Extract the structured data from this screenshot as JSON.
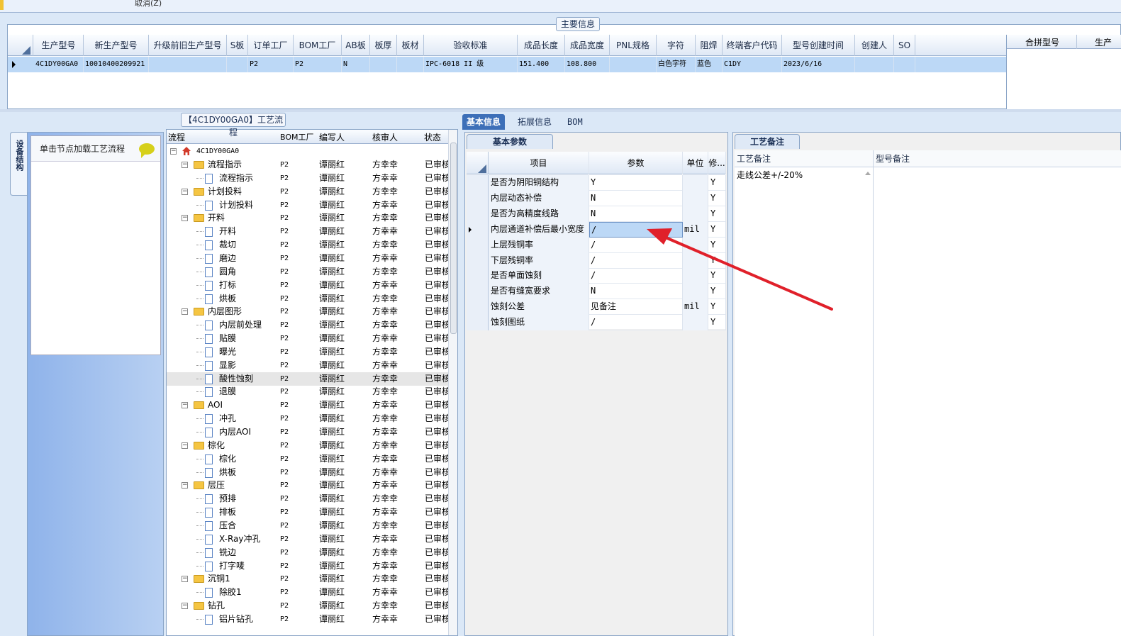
{
  "top_strip": {
    "text": "取消(Z)"
  },
  "main_info": {
    "caption": "主要信息",
    "headers": [
      "生产型号",
      "新生产型号",
      "升级前旧生产型号",
      "S板",
      "订单工厂",
      "BOM工厂",
      "AB板",
      "板厚",
      "板材",
      "验收标准",
      "成品长度",
      "成品宽度",
      "PNL规格",
      "字符",
      "阻焊",
      "终端客户代码",
      "型号创建时间",
      "创建人",
      "SO"
    ],
    "row": [
      "4C1DY00GA0",
      "10010400209921",
      "",
      "",
      "P2",
      "P2",
      "N",
      "",
      "",
      "IPC-6018 II 级",
      "151.400",
      "108.800",
      "",
      "白色字符",
      "蓝色",
      "C1DY",
      "2023/6/16",
      "",
      ""
    ],
    "right_headers": [
      "合拼型号",
      "生产"
    ]
  },
  "device_panel": {
    "tab_label": "设备结构",
    "button_label": "单击节点加载工艺流程"
  },
  "process_tree": {
    "caption": "【4C1DY00GA0】工艺流程",
    "headers": [
      "流程",
      "BOM工厂",
      "编写人",
      "核审人",
      "状态"
    ],
    "root": "4C1DY00GA0",
    "rows": [
      {
        "name": "流程指示",
        "level": 1,
        "factory": "P2",
        "writer": "谭丽红",
        "reviewer": "方幸幸",
        "status": "已审核"
      },
      {
        "name": "流程指示",
        "level": 2,
        "factory": "P2",
        "writer": "谭丽红",
        "reviewer": "方幸幸",
        "status": "已审核"
      },
      {
        "name": "计划投料",
        "level": 1,
        "factory": "P2",
        "writer": "谭丽红",
        "reviewer": "方幸幸",
        "status": "已审核"
      },
      {
        "name": "计划投料",
        "level": 2,
        "factory": "P2",
        "writer": "谭丽红",
        "reviewer": "方幸幸",
        "status": "已审核"
      },
      {
        "name": "开料",
        "level": 1,
        "factory": "P2",
        "writer": "谭丽红",
        "reviewer": "方幸幸",
        "status": "已审核"
      },
      {
        "name": "开料",
        "level": 2,
        "factory": "P2",
        "writer": "谭丽红",
        "reviewer": "方幸幸",
        "status": "已审核"
      },
      {
        "name": "裁切",
        "level": 2,
        "factory": "P2",
        "writer": "谭丽红",
        "reviewer": "方幸幸",
        "status": "已审核"
      },
      {
        "name": "磨边",
        "level": 2,
        "factory": "P2",
        "writer": "谭丽红",
        "reviewer": "方幸幸",
        "status": "已审核"
      },
      {
        "name": "圆角",
        "level": 2,
        "factory": "P2",
        "writer": "谭丽红",
        "reviewer": "方幸幸",
        "status": "已审核"
      },
      {
        "name": "打标",
        "level": 2,
        "factory": "P2",
        "writer": "谭丽红",
        "reviewer": "方幸幸",
        "status": "已审核"
      },
      {
        "name": "烘板",
        "level": 2,
        "factory": "P2",
        "writer": "谭丽红",
        "reviewer": "方幸幸",
        "status": "已审核"
      },
      {
        "name": "内层图形",
        "level": 1,
        "factory": "P2",
        "writer": "谭丽红",
        "reviewer": "方幸幸",
        "status": "已审核"
      },
      {
        "name": "内层前处理",
        "level": 2,
        "factory": "P2",
        "writer": "谭丽红",
        "reviewer": "方幸幸",
        "status": "已审核"
      },
      {
        "name": "贴膜",
        "level": 2,
        "factory": "P2",
        "writer": "谭丽红",
        "reviewer": "方幸幸",
        "status": "已审核"
      },
      {
        "name": "曝光",
        "level": 2,
        "factory": "P2",
        "writer": "谭丽红",
        "reviewer": "方幸幸",
        "status": "已审核"
      },
      {
        "name": "显影",
        "level": 2,
        "factory": "P2",
        "writer": "谭丽红",
        "reviewer": "方幸幸",
        "status": "已审核"
      },
      {
        "name": "酸性蚀刻",
        "level": 2,
        "factory": "P2",
        "writer": "谭丽红",
        "reviewer": "方幸幸",
        "status": "已审核",
        "selected": true
      },
      {
        "name": "退膜",
        "level": 2,
        "factory": "P2",
        "writer": "谭丽红",
        "reviewer": "方幸幸",
        "status": "已审核"
      },
      {
        "name": "AOI",
        "level": 1,
        "factory": "P2",
        "writer": "谭丽红",
        "reviewer": "方幸幸",
        "status": "已审核"
      },
      {
        "name": "冲孔",
        "level": 2,
        "factory": "P2",
        "writer": "谭丽红",
        "reviewer": "方幸幸",
        "status": "已审核"
      },
      {
        "name": "内层AOI",
        "level": 2,
        "factory": "P2",
        "writer": "谭丽红",
        "reviewer": "方幸幸",
        "status": "已审核"
      },
      {
        "name": "棕化",
        "level": 1,
        "factory": "P2",
        "writer": "谭丽红",
        "reviewer": "方幸幸",
        "status": "已审核"
      },
      {
        "name": "棕化",
        "level": 2,
        "factory": "P2",
        "writer": "谭丽红",
        "reviewer": "方幸幸",
        "status": "已审核"
      },
      {
        "name": "烘板",
        "level": 2,
        "factory": "P2",
        "writer": "谭丽红",
        "reviewer": "方幸幸",
        "status": "已审核"
      },
      {
        "name": "层压",
        "level": 1,
        "factory": "P2",
        "writer": "谭丽红",
        "reviewer": "方幸幸",
        "status": "已审核"
      },
      {
        "name": "预排",
        "level": 2,
        "factory": "P2",
        "writer": "谭丽红",
        "reviewer": "方幸幸",
        "status": "已审核"
      },
      {
        "name": "排板",
        "level": 2,
        "factory": "P2",
        "writer": "谭丽红",
        "reviewer": "方幸幸",
        "status": "已审核"
      },
      {
        "name": "压合",
        "level": 2,
        "factory": "P2",
        "writer": "谭丽红",
        "reviewer": "方幸幸",
        "status": "已审核"
      },
      {
        "name": "X-Ray冲孔",
        "level": 2,
        "factory": "P2",
        "writer": "谭丽红",
        "reviewer": "方幸幸",
        "status": "已审核"
      },
      {
        "name": "铣边",
        "level": 2,
        "factory": "P2",
        "writer": "谭丽红",
        "reviewer": "方幸幸",
        "status": "已审核"
      },
      {
        "name": "打字唛",
        "level": 2,
        "factory": "P2",
        "writer": "谭丽红",
        "reviewer": "方幸幸",
        "status": "已审核"
      },
      {
        "name": "沉铜1",
        "level": 1,
        "factory": "P2",
        "writer": "谭丽红",
        "reviewer": "方幸幸",
        "status": "已审核"
      },
      {
        "name": "除胶1",
        "level": 2,
        "factory": "P2",
        "writer": "谭丽红",
        "reviewer": "方幸幸",
        "status": "已审核"
      },
      {
        "name": "钻孔",
        "level": 1,
        "factory": "P2",
        "writer": "谭丽红",
        "reviewer": "方幸幸",
        "status": "已审核"
      },
      {
        "name": "铝片钻孔",
        "level": 2,
        "factory": "P2",
        "writer": "谭丽红",
        "reviewer": "方幸幸",
        "status": "已审核"
      }
    ]
  },
  "tabs": [
    "基本信息",
    "拓展信息",
    "BOM"
  ],
  "basic_params": {
    "title": "基本参数",
    "headers": [
      "项目",
      "参数",
      "单位",
      "修..."
    ],
    "rows": [
      {
        "item": "是否为阴阳铜结构",
        "value": "Y",
        "unit": "",
        "mod": "Y"
      },
      {
        "item": "内层动态补偿",
        "value": "N",
        "unit": "",
        "mod": "Y"
      },
      {
        "item": "是否为高精度线路",
        "value": "N",
        "unit": "",
        "mod": "Y"
      },
      {
        "item": "内层通道补偿后最小宽度",
        "value": "/",
        "unit": "mil",
        "mod": "Y",
        "current": true
      },
      {
        "item": "上层残铜率",
        "value": "/",
        "unit": "",
        "mod": "Y"
      },
      {
        "item": "下层残铜率",
        "value": "/",
        "unit": "",
        "mod": "Y"
      },
      {
        "item": "是否单面蚀刻",
        "value": "/",
        "unit": "",
        "mod": "Y"
      },
      {
        "item": "是否有缝宽要求",
        "value": "N",
        "unit": "",
        "mod": "Y"
      },
      {
        "item": "蚀刻公差",
        "value": "见备注",
        "unit": "mil",
        "mod": "Y"
      },
      {
        "item": "蚀刻图纸",
        "value": "/",
        "unit": "",
        "mod": "Y"
      }
    ]
  },
  "remarks": {
    "title": "工艺备注",
    "col1_header": "工艺备注",
    "col1_text": "走线公差+/-20%",
    "col2_header": "型号备注"
  },
  "colors": {
    "accent": "#3d6fb8",
    "selection": "#bcd8f6",
    "arrow": "#e0202a"
  }
}
